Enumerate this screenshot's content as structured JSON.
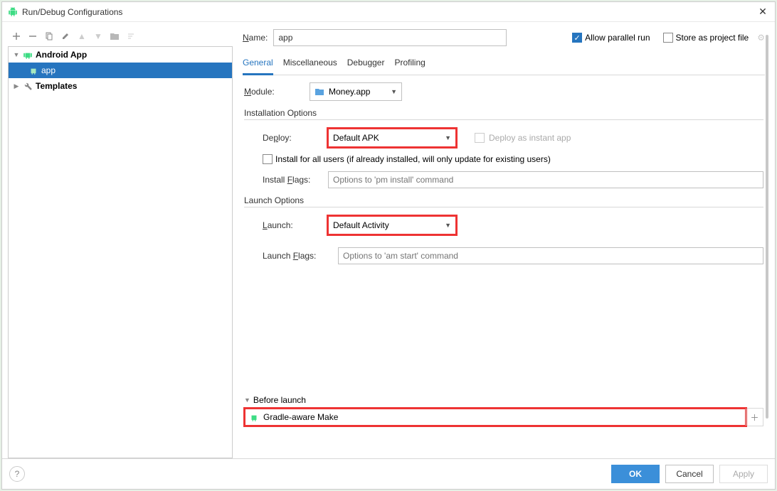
{
  "window": {
    "title": "Run/Debug Configurations"
  },
  "tree": {
    "nodes": [
      {
        "label": "Android App",
        "type": "android-group",
        "expanded": true,
        "bold": true
      },
      {
        "label": "app",
        "type": "android-config",
        "selected": true,
        "indent": 1
      },
      {
        "label": "Templates",
        "type": "templates",
        "expanded": false,
        "bold": true
      }
    ]
  },
  "form": {
    "name_label": "Name:",
    "name_value": "app",
    "allow_parallel_label": "Allow parallel run",
    "allow_parallel_checked": true,
    "store_project_label": "Store as project file",
    "store_project_checked": false,
    "tabs": [
      "General",
      "Miscellaneous",
      "Debugger",
      "Profiling"
    ],
    "active_tab": 0,
    "module_label": "Module:",
    "module_value": "Money.app",
    "install_section": "Installation Options",
    "deploy_label": "Deploy:",
    "deploy_value": "Default APK",
    "deploy_instant_label": "Deploy as instant app",
    "install_all_label": "Install for all users (if already installed, will only update for existing users)",
    "install_flags_label": "Install Flags:",
    "install_flags_placeholder": "Options to 'pm install' command",
    "launch_section": "Launch Options",
    "launch_label": "Launch:",
    "launch_value": "Default Activity",
    "launch_flags_label": "Launch Flags:",
    "launch_flags_placeholder": "Options to 'am start' command",
    "before_launch_label": "Before launch",
    "before_launch_item": "Gradle-aware Make"
  },
  "footer": {
    "ok": "OK",
    "cancel": "Cancel",
    "apply": "Apply"
  }
}
